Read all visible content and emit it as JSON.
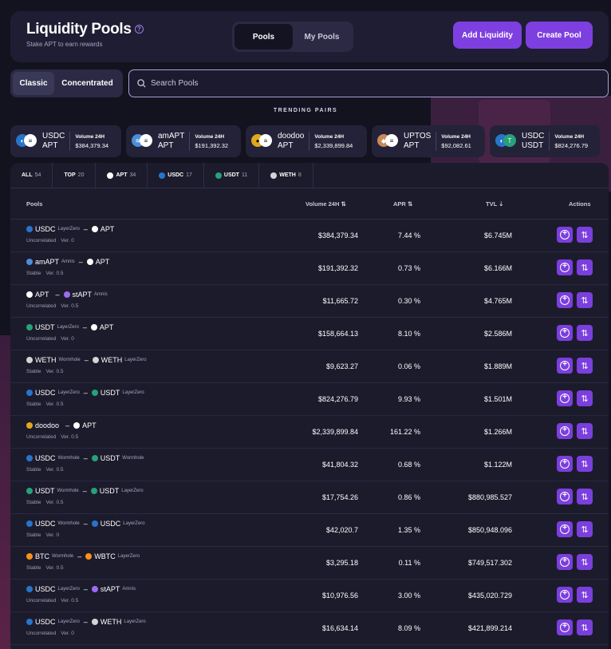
{
  "header": {
    "title": "Liquidity Pools",
    "subtitle": "Stake APT to earn rewards",
    "tabs": [
      "Pools",
      "My Pools"
    ],
    "add_liquidity": "Add Liquidity",
    "create_pool": "Create Pool"
  },
  "mode": {
    "classic": "Classic",
    "concentrated": "Concentrated"
  },
  "search": {
    "placeholder": "Search Pools"
  },
  "trending": {
    "title": "TRENDING PAIRS",
    "volume_label": "Volume 24H",
    "items": [
      {
        "a": "USDC",
        "b": "APT",
        "volume": "$384,379.34"
      },
      {
        "a": "amAPT",
        "b": "APT",
        "volume": "$191,392.32"
      },
      {
        "a": "doodoo",
        "b": "APT",
        "volume": "$2,339,899.84"
      },
      {
        "a": "UPTOS",
        "b": "APT",
        "volume": "$92,082.61"
      },
      {
        "a": "USDC",
        "b": "USDT",
        "volume": "$824,276.79"
      }
    ]
  },
  "filter_tabs": [
    {
      "label": "ALL",
      "count": "54"
    },
    {
      "label": "TOP",
      "count": "20"
    },
    {
      "label": "APT",
      "count": "34"
    },
    {
      "label": "USDC",
      "count": "17"
    },
    {
      "label": "USDT",
      "count": "11"
    },
    {
      "label": "WETH",
      "count": "8"
    }
  ],
  "columns": {
    "pools": "Pools",
    "volume": "Volume 24H",
    "apr": "APR",
    "tvl": "TVL",
    "actions": "Actions"
  },
  "pools": [
    {
      "t1": "USDC",
      "t1tag": "LayerZero",
      "t2": "APT",
      "t2tag": "",
      "curve": "Uncorrelated",
      "ver": "Ver. 0",
      "volume": "$384,379.34",
      "apr": "7.44 %",
      "tvl": "$6.745M"
    },
    {
      "t1": "amAPT",
      "t1tag": "Amnis",
      "t2": "APT",
      "t2tag": "",
      "curve": "Stable",
      "ver": "Ver. 0.5",
      "volume": "$191,392.32",
      "apr": "0.73 %",
      "tvl": "$6.166M"
    },
    {
      "t1": "APT",
      "t1tag": "",
      "t2": "stAPT",
      "t2tag": "Amnis",
      "curve": "Uncorrelated",
      "ver": "Ver. 0.5",
      "volume": "$11,665.72",
      "apr": "0.30 %",
      "tvl": "$4.765M"
    },
    {
      "t1": "USDT",
      "t1tag": "LayerZero",
      "t2": "APT",
      "t2tag": "",
      "curve": "Uncorrelated",
      "ver": "Ver. 0",
      "volume": "$158,664.13",
      "apr": "8.10 %",
      "tvl": "$2.586M"
    },
    {
      "t1": "WETH",
      "t1tag": "Wormhole",
      "t2": "WETH",
      "t2tag": "LayerZero",
      "curve": "Stable",
      "ver": "Ver. 0.5",
      "volume": "$9,623.27",
      "apr": "0.06 %",
      "tvl": "$1.889M"
    },
    {
      "t1": "USDC",
      "t1tag": "LayerZero",
      "t2": "USDT",
      "t2tag": "LayerZero",
      "curve": "Stable",
      "ver": "Ver. 0.5",
      "volume": "$824,276.79",
      "apr": "9.93 %",
      "tvl": "$1.501M"
    },
    {
      "t1": "doodoo",
      "t1tag": "",
      "t2": "APT",
      "t2tag": "",
      "curve": "Uncorrelated",
      "ver": "Ver. 0.5",
      "volume": "$2,339,899.84",
      "apr": "161.22 %",
      "tvl": "$1.266M"
    },
    {
      "t1": "USDC",
      "t1tag": "Wormhole",
      "t2": "USDT",
      "t2tag": "Wormhole",
      "curve": "Stable",
      "ver": "Ver. 0.5",
      "volume": "$41,804.32",
      "apr": "0.68 %",
      "tvl": "$1.122M"
    },
    {
      "t1": "USDT",
      "t1tag": "Wormhole",
      "t2": "USDT",
      "t2tag": "LayerZero",
      "curve": "Stable",
      "ver": "Ver. 0.5",
      "volume": "$17,754.26",
      "apr": "0.86 %",
      "tvl": "$880,985.527"
    },
    {
      "t1": "USDC",
      "t1tag": "Wormhole",
      "t2": "USDC",
      "t2tag": "LayerZero",
      "curve": "Stable",
      "ver": "Ver. 0",
      "volume": "$42,020.7",
      "apr": "1.35 %",
      "tvl": "$850,948.096"
    },
    {
      "t1": "BTC",
      "t1tag": "Wormhole",
      "t2": "WBTC",
      "t2tag": "LayerZero",
      "curve": "Stable",
      "ver": "Ver. 0.5",
      "volume": "$3,295.18",
      "apr": "0.11 %",
      "tvl": "$749,517.302"
    },
    {
      "t1": "USDC",
      "t1tag": "LayerZero",
      "t2": "stAPT",
      "t2tag": "Amnis",
      "curve": "Uncorrelated",
      "ver": "Ver. 0.5",
      "volume": "$10,976.56",
      "apr": "3.00 %",
      "tvl": "$435,020.729"
    },
    {
      "t1": "USDC",
      "t1tag": "LayerZero",
      "t2": "WETH",
      "t2tag": "LayerZero",
      "curve": "Uncorrelated",
      "ver": "Ver. 0",
      "volume": "$16,634.14",
      "apr": "8.09 %",
      "tvl": "$421,899.214"
    }
  ],
  "colors": {
    "accent": "#7e3fe0",
    "usdc": "#2775ca",
    "usdt": "#26a17b",
    "apt": "#ffffff",
    "weth": "#d4d4d4",
    "btc": "#f7931a",
    "doodoo": "#e0a81e",
    "amnis": "#9b6cf0"
  }
}
